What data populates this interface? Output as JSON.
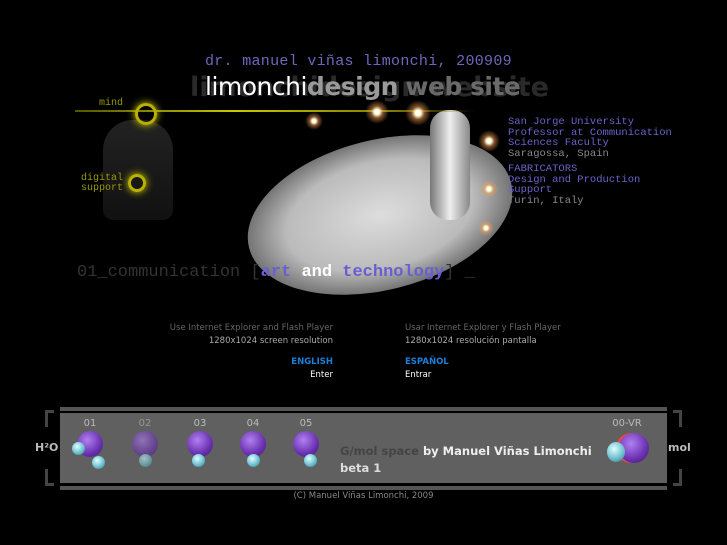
{
  "header": {
    "title": "dr. manuel viñas limonchi, 200909",
    "site_a": "limonchi",
    "site_b": "design",
    "site_c": "web site",
    "ghost": "limonchidesign website"
  },
  "labels": {
    "mind": "mind",
    "digital": "digital",
    "support": "support"
  },
  "info": {
    "lines": [
      "San Jorge University",
      "Professor at Communication",
      "Sciences Faculty",
      "Saragossa, Spain"
    ],
    "fab": [
      "FABRICATORS",
      "Design and Production",
      "Support",
      "Turin, Italy"
    ]
  },
  "tagline": {
    "prefix": "01_communication [",
    "art": "art",
    "and": "and",
    "tech": "technology",
    "suffix": "] _"
  },
  "english": {
    "note1": "Use Internet Explorer and Flash Player",
    "note2": "1280x1024 screen resolution",
    "lang": "ENGLISH",
    "enter": "Enter"
  },
  "spanish": {
    "note1": "Usar Internet Explorer y Flash Player",
    "note2": "1280x1024 resolución pantalla",
    "lang": "ESPAÑOL",
    "enter": "Entrar"
  },
  "bar": {
    "left": "H²O",
    "right": "mol",
    "items": [
      "01",
      "02",
      "03",
      "04",
      "05"
    ],
    "vr": "00-VR",
    "gmol": "G/mol space",
    "by": "by Manuel Viñas Limonchi",
    "beta": "beta 1"
  },
  "footer": {
    "copyright": "(C) Manuel Viñas Limonchi, 2009"
  }
}
